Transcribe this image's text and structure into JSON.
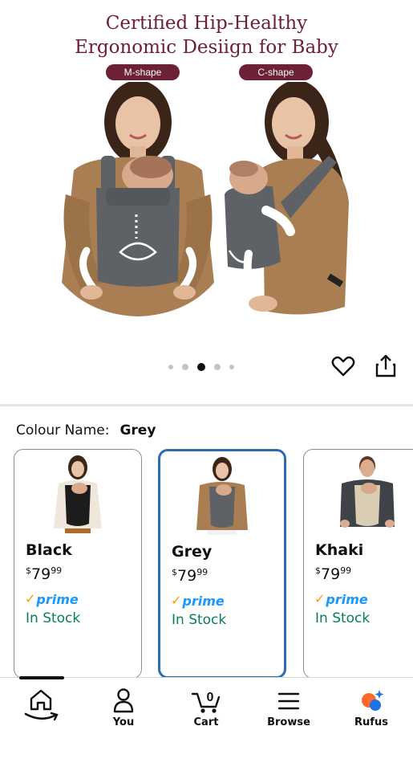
{
  "hero": {
    "title_line1": "Certified Hip-Healthy",
    "title_line2": "Ergonomic Desiign for Baby",
    "label_left": "M-shape",
    "label_right": "C-shape",
    "carousel": {
      "count": 5,
      "active_index": 2
    }
  },
  "actions": {
    "favorite_icon": "heart-icon",
    "share_icon": "share-icon"
  },
  "colour": {
    "label": "Colour Name:",
    "selected": "Grey",
    "options": [
      {
        "name": "Black",
        "price_symbol": "$",
        "price_whole": "79",
        "price_fraction": "99",
        "prime_check": "✓",
        "prime": "prime",
        "availability": "In Stock",
        "carrier_color": "#1c1c1c"
      },
      {
        "name": "Grey",
        "price_symbol": "$",
        "price_whole": "79",
        "price_fraction": "99",
        "prime_check": "✓",
        "prime": "prime",
        "availability": "In Stock",
        "carrier_color": "#5e6266"
      },
      {
        "name": "Khaki",
        "price_symbol": "$",
        "price_whole": "79",
        "price_fraction": "99",
        "prime_check": "✓",
        "prime": "prime",
        "availability": "In Stock",
        "carrier_color": "#d9cdb4"
      }
    ]
  },
  "nav": {
    "items": [
      {
        "label": "",
        "icon": "home-icon"
      },
      {
        "label": "You",
        "icon": "user-icon"
      },
      {
        "label": "Cart",
        "icon": "cart-icon",
        "badge": "0"
      },
      {
        "label": "Browse",
        "icon": "menu-icon"
      },
      {
        "label": "Rufus",
        "icon": "rufus-icon"
      }
    ]
  },
  "colors": {
    "title": "#6d2136",
    "selected_border": "#2a6db0",
    "prime_blue": "#1a98ff",
    "prime_check": "#ff9900",
    "stock_green": "#067d62"
  }
}
